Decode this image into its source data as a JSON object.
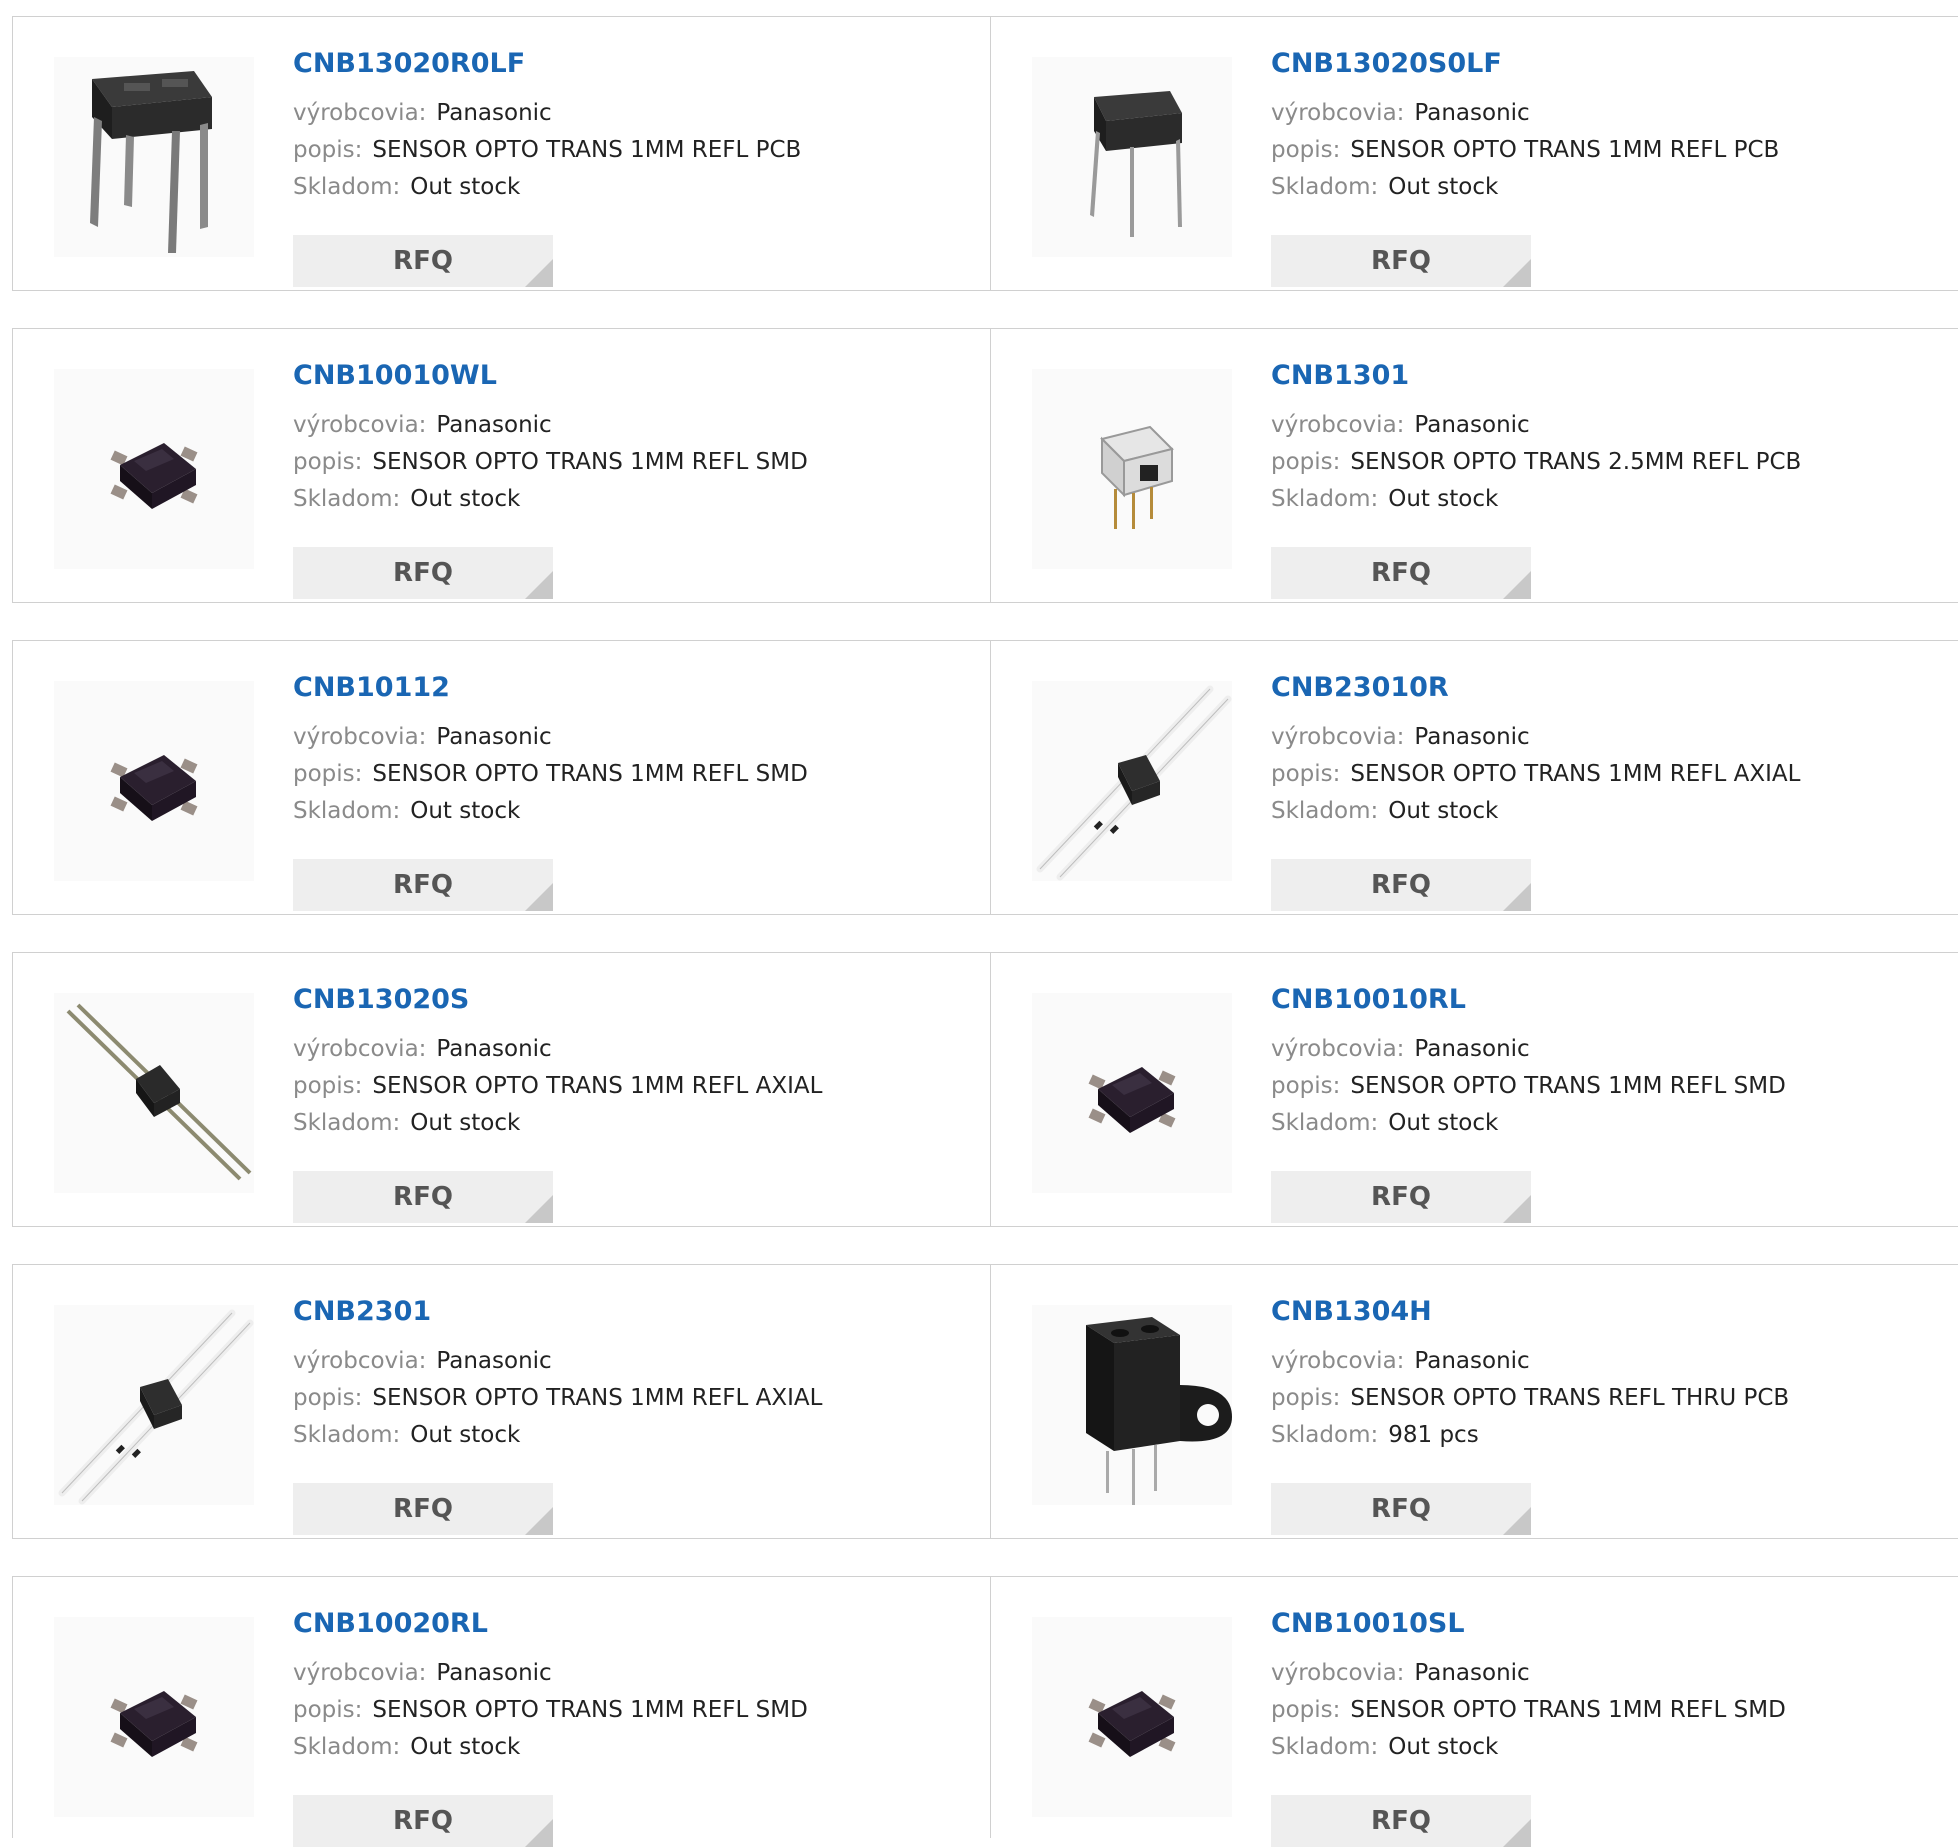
{
  "labels": {
    "manufacturer": "výrobcovia:",
    "description": "popis:",
    "stock": "Skladom:",
    "rfq": "RFQ"
  },
  "products": [
    {
      "name": "CNB13020R0LF",
      "manufacturer": "Panasonic",
      "description": "SENSOR OPTO TRANS 1MM REFL PCB",
      "stock": "Out stock",
      "image": "opto-pcb-large-icon"
    },
    {
      "name": "CNB13020S0LF",
      "manufacturer": "Panasonic",
      "description": "SENSOR OPTO TRANS 1MM REFL PCB",
      "stock": "Out stock",
      "image": "opto-pcb-small-icon"
    },
    {
      "name": "CNB10010WL",
      "manufacturer": "Panasonic",
      "description": "SENSOR OPTO TRANS 1MM REFL SMD",
      "stock": "Out stock",
      "image": "opto-smd-icon"
    },
    {
      "name": "CNB1301",
      "manufacturer": "Panasonic",
      "description": "SENSOR OPTO TRANS 2.5MM REFL PCB",
      "stock": "Out stock",
      "image": "opto-clear-pcb-icon"
    },
    {
      "name": "CNB10112",
      "manufacturer": "Panasonic",
      "description": "SENSOR OPTO TRANS 1MM REFL SMD",
      "stock": "Out stock",
      "image": "opto-smd-icon"
    },
    {
      "name": "CNB23010R",
      "manufacturer": "Panasonic",
      "description": "SENSOR OPTO TRANS 1MM REFL AXIAL",
      "stock": "Out stock",
      "image": "opto-axial-white-icon"
    },
    {
      "name": "CNB13020S",
      "manufacturer": "Panasonic",
      "description": "SENSOR OPTO TRANS 1MM REFL AXIAL",
      "stock": "Out stock",
      "image": "opto-axial-metal-icon"
    },
    {
      "name": "CNB10010RL",
      "manufacturer": "Panasonic",
      "description": "SENSOR OPTO TRANS 1MM REFL SMD",
      "stock": "Out stock",
      "image": "opto-smd-icon"
    },
    {
      "name": "CNB2301",
      "manufacturer": "Panasonic",
      "description": "SENSOR OPTO TRANS 1MM REFL AXIAL",
      "stock": "Out stock",
      "image": "opto-axial-white-icon"
    },
    {
      "name": "CNB1304H",
      "manufacturer": "Panasonic",
      "description": "SENSOR OPTO TRANS REFL THRU PCB",
      "stock": "981 pcs",
      "image": "opto-block-icon"
    },
    {
      "name": "CNB10020RL",
      "manufacturer": "Panasonic",
      "description": "SENSOR OPTO TRANS 1MM REFL SMD",
      "stock": "Out stock",
      "image": "opto-smd-icon"
    },
    {
      "name": "CNB10010SL",
      "manufacturer": "Panasonic",
      "description": "SENSOR OPTO TRANS 1MM REFL SMD",
      "stock": "Out stock",
      "image": "opto-smd-icon"
    }
  ],
  "colors": {
    "title": "#1a66b3",
    "label": "#8a8a8a",
    "button_bg": "#eeeeee",
    "border": "#d0d0d0"
  }
}
